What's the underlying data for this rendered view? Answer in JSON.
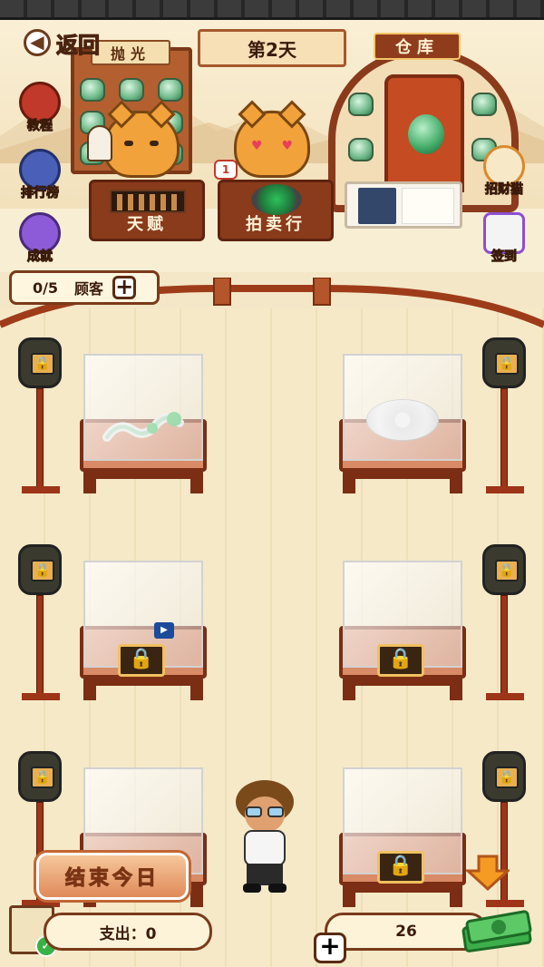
{
  "header": {
    "back_label": "返回",
    "day_label": "第2天",
    "warehouse_label": "仓库",
    "polish_label": "抛光"
  },
  "side_left": {
    "tutorial": "教程",
    "ranking": "排行榜",
    "achievement": "成就"
  },
  "side_right": {
    "lucky_cat": "招财猫",
    "checkin": "签到"
  },
  "counter": {
    "talent_label": "天赋",
    "auction_label": "拍卖行",
    "notification_count": "1"
  },
  "customers": {
    "count": "0/5",
    "label": "顾客"
  },
  "footer": {
    "end_day_label": "结束今日",
    "expense_label": "支出：0",
    "money_value": "26"
  },
  "colors": {
    "wood_dark": "#7b2e14",
    "wood_mid": "#b4552b",
    "floor": "#f6e9c8",
    "jade_green": "#2ec05b",
    "gold": "#f0c060"
  },
  "display_cases": [
    {
      "slot": 1,
      "state": "jade-dragon"
    },
    {
      "slot": 2,
      "state": "white-bi-disc"
    },
    {
      "slot": 3,
      "state": "locked-video"
    },
    {
      "slot": 4,
      "state": "locked"
    },
    {
      "slot": 5,
      "state": "locked"
    },
    {
      "slot": 6,
      "state": "locked"
    }
  ]
}
